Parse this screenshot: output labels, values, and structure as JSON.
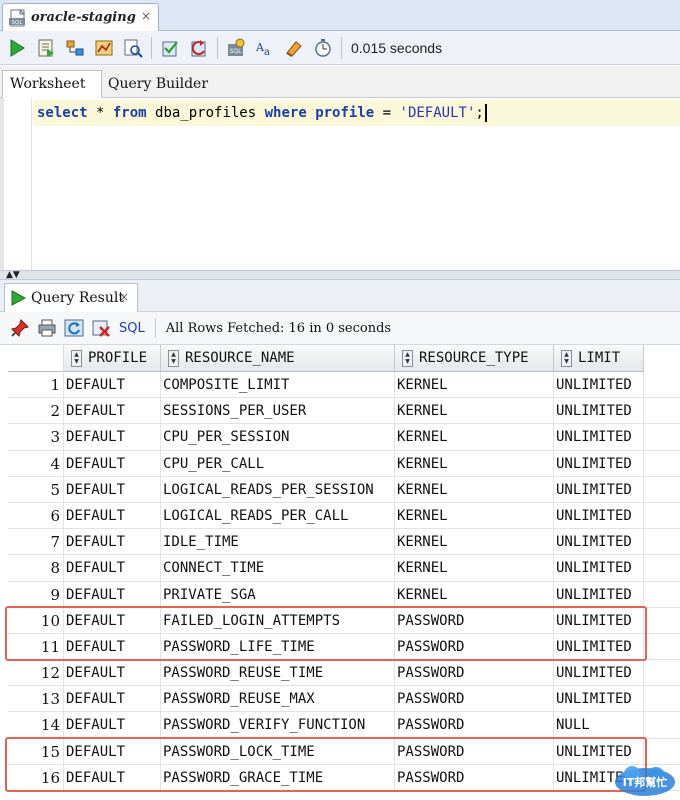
{
  "connection_tab": {
    "title": "oracle-staging",
    "close": "×",
    "icon": "sql-file-icon"
  },
  "toolbar": {
    "timing": "0.015 seconds",
    "icons": [
      "run-statement-icon",
      "run-script-icon",
      "explain-plan-icon",
      "autotrace-icon",
      "sql-tuning-icon",
      "commit-icon",
      "rollback-icon",
      "sql-history-icon",
      "unshared-worksheet-icon",
      "clear-icon",
      "timer-icon"
    ]
  },
  "worksheet_tabs": [
    {
      "label": "Worksheet",
      "active": true
    },
    {
      "label": "Query Builder",
      "active": false
    }
  ],
  "editor": {
    "tokens": [
      {
        "text": "select",
        "type": "kw"
      },
      {
        "text": " * ",
        "type": "plain"
      },
      {
        "text": "from",
        "type": "kw"
      },
      {
        "text": " dba_profiles ",
        "type": "plain"
      },
      {
        "text": "where",
        "type": "kw"
      },
      {
        "text": " ",
        "type": "plain"
      },
      {
        "text": "profile",
        "type": "kw"
      },
      {
        "text": " = ",
        "type": "plain"
      },
      {
        "text": "'DEFAULT'",
        "type": "str"
      },
      {
        "text": ";",
        "type": "plain"
      }
    ]
  },
  "result_tab": {
    "label": "Query Result",
    "close": "×"
  },
  "result_toolbar": {
    "sql_label": "SQL",
    "status": "All Rows Fetched: 16 in 0 seconds",
    "icons": [
      "pin-icon",
      "print-icon",
      "refresh-icon",
      "cancel-icon"
    ]
  },
  "grid": {
    "columns": [
      "PROFILE",
      "RESOURCE_NAME",
      "RESOURCE_TYPE",
      "LIMIT"
    ],
    "rows": [
      [
        "1",
        "DEFAULT",
        "COMPOSITE_LIMIT",
        "KERNEL",
        "UNLIMITED"
      ],
      [
        "2",
        "DEFAULT",
        "SESSIONS_PER_USER",
        "KERNEL",
        "UNLIMITED"
      ],
      [
        "3",
        "DEFAULT",
        "CPU_PER_SESSION",
        "KERNEL",
        "UNLIMITED"
      ],
      [
        "4",
        "DEFAULT",
        "CPU_PER_CALL",
        "KERNEL",
        "UNLIMITED"
      ],
      [
        "5",
        "DEFAULT",
        "LOGICAL_READS_PER_SESSION",
        "KERNEL",
        "UNLIMITED"
      ],
      [
        "6",
        "DEFAULT",
        "LOGICAL_READS_PER_CALL",
        "KERNEL",
        "UNLIMITED"
      ],
      [
        "7",
        "DEFAULT",
        "IDLE_TIME",
        "KERNEL",
        "UNLIMITED"
      ],
      [
        "8",
        "DEFAULT",
        "CONNECT_TIME",
        "KERNEL",
        "UNLIMITED"
      ],
      [
        "9",
        "DEFAULT",
        "PRIVATE_SGA",
        "KERNEL",
        "UNLIMITED"
      ],
      [
        "10",
        "DEFAULT",
        "FAILED_LOGIN_ATTEMPTS",
        "PASSWORD",
        "UNLIMITED"
      ],
      [
        "11",
        "DEFAULT",
        "PASSWORD_LIFE_TIME",
        "PASSWORD",
        "UNLIMITED"
      ],
      [
        "12",
        "DEFAULT",
        "PASSWORD_REUSE_TIME",
        "PASSWORD",
        "UNLIMITED"
      ],
      [
        "13",
        "DEFAULT",
        "PASSWORD_REUSE_MAX",
        "PASSWORD",
        "UNLIMITED"
      ],
      [
        "14",
        "DEFAULT",
        "PASSWORD_VERIFY_FUNCTION",
        "PASSWORD",
        "NULL"
      ],
      [
        "15",
        "DEFAULT",
        "PASSWORD_LOCK_TIME",
        "PASSWORD",
        "UNLIMITED"
      ],
      [
        "16",
        "DEFAULT",
        "PASSWORD_GRACE_TIME",
        "PASSWORD",
        "UNLIMITED"
      ]
    ],
    "highlighted_rows": [
      [
        10,
        11
      ],
      [
        15,
        16
      ]
    ],
    "highlight_color": "#e8624f"
  },
  "watermark": {
    "text": "IT邦幫忙",
    "icon": "ithome-logo"
  }
}
